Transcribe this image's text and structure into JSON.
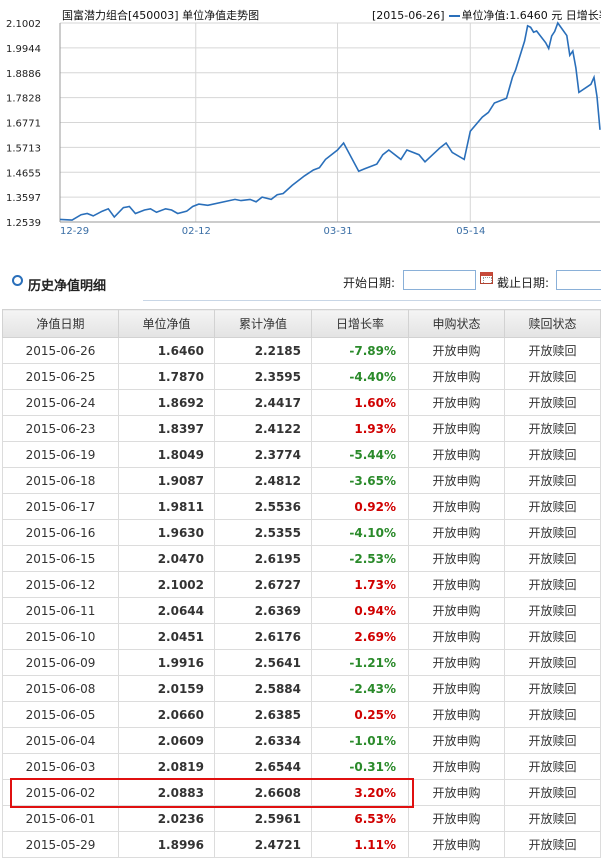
{
  "chart": {
    "title": "国富潜力组合[450003] 单位净值走势图",
    "legend": {
      "date": "[2015-06-26]",
      "series_label": "单位净值",
      "value": "1.6460",
      "unit": "元",
      "rate_label": "日增长率"
    },
    "y_ticks": [
      "2.1002",
      "1.9944",
      "1.8886",
      "1.7828",
      "1.6771",
      "1.5713",
      "1.4655",
      "1.3597",
      "1.2539"
    ],
    "x_ticks": [
      "12-29",
      "02-12",
      "03-31",
      "05-14"
    ],
    "line_color": "#2a6fba"
  },
  "chart_data": {
    "type": "line",
    "ylim": [
      1.2539,
      2.1002
    ],
    "grid": true,
    "x": [
      "2014-12-29",
      "2015-01-02",
      "2015-01-05",
      "2015-01-07",
      "2015-01-09",
      "2015-01-12",
      "2015-01-14",
      "2015-01-16",
      "2015-01-19",
      "2015-01-21",
      "2015-01-23",
      "2015-01-26",
      "2015-01-28",
      "2015-01-30",
      "2015-02-02",
      "2015-02-04",
      "2015-02-06",
      "2015-02-09",
      "2015-02-11",
      "2015-02-13",
      "2015-02-16",
      "2015-02-25",
      "2015-02-27",
      "2015-03-02",
      "2015-03-04",
      "2015-03-06",
      "2015-03-09",
      "2015-03-11",
      "2015-03-13",
      "2015-03-16",
      "2015-03-18",
      "2015-03-20",
      "2015-03-23",
      "2015-03-25",
      "2015-03-27",
      "2015-03-31",
      "2015-04-02",
      "2015-04-07",
      "2015-04-09",
      "2015-04-13",
      "2015-04-15",
      "2015-04-17",
      "2015-04-21",
      "2015-04-23",
      "2015-04-27",
      "2015-04-29",
      "2015-05-04",
      "2015-05-06",
      "2015-05-08",
      "2015-05-12",
      "2015-05-14",
      "2015-05-18",
      "2015-05-20",
      "2015-05-22",
      "2015-05-26",
      "2015-05-28",
      "2015-05-29",
      "2015-06-01",
      "2015-06-02",
      "2015-06-03",
      "2015-06-04",
      "2015-06-05",
      "2015-06-08",
      "2015-06-09",
      "2015-06-10",
      "2015-06-11",
      "2015-06-12",
      "2015-06-15",
      "2015-06-16",
      "2015-06-17",
      "2015-06-18",
      "2015-06-19",
      "2015-06-23",
      "2015-06-24",
      "2015-06-25",
      "2015-06-26"
    ],
    "series": [
      {
        "values": [
          1.265,
          1.262,
          1.285,
          1.29,
          1.28,
          1.3,
          1.31,
          1.275,
          1.315,
          1.32,
          1.29,
          1.305,
          1.31,
          1.295,
          1.31,
          1.305,
          1.29,
          1.3,
          1.32,
          1.33,
          1.325,
          1.35,
          1.345,
          1.35,
          1.34,
          1.36,
          1.35,
          1.37,
          1.375,
          1.41,
          1.43,
          1.45,
          1.475,
          1.485,
          1.52,
          1.56,
          1.59,
          1.47,
          1.48,
          1.5,
          1.54,
          1.56,
          1.52,
          1.56,
          1.54,
          1.51,
          1.57,
          1.59,
          1.55,
          1.52,
          1.64,
          1.7,
          1.72,
          1.76,
          1.78,
          1.87,
          1.8996,
          2.0236,
          2.0883,
          2.0819,
          2.0609,
          2.066,
          2.0159,
          1.9916,
          2.0451,
          2.0644,
          2.1002,
          2.047,
          1.963,
          1.9811,
          1.9087,
          1.8049,
          1.8397,
          1.8692,
          1.787,
          1.646
        ]
      }
    ]
  },
  "section": {
    "title": "历史净值明细",
    "start_label": "开始日期:",
    "start_value": "",
    "end_label": "截止日期:",
    "end_value": ""
  },
  "table": {
    "headers": [
      "净值日期",
      "单位净值",
      "累计净值",
      "日增长率",
      "申购状态",
      "赎回状态"
    ],
    "rows": [
      {
        "date": "2015-06-26",
        "nav": "1.6460",
        "acc": "2.2185",
        "chg": "-7.89%",
        "dir": "down",
        "buy": "开放申购",
        "red": "开放赎回"
      },
      {
        "date": "2015-06-25",
        "nav": "1.7870",
        "acc": "2.3595",
        "chg": "-4.40%",
        "dir": "down",
        "buy": "开放申购",
        "red": "开放赎回"
      },
      {
        "date": "2015-06-24",
        "nav": "1.8692",
        "acc": "2.4417",
        "chg": "1.60%",
        "dir": "up",
        "buy": "开放申购",
        "red": "开放赎回"
      },
      {
        "date": "2015-06-23",
        "nav": "1.8397",
        "acc": "2.4122",
        "chg": "1.93%",
        "dir": "up",
        "buy": "开放申购",
        "red": "开放赎回"
      },
      {
        "date": "2015-06-19",
        "nav": "1.8049",
        "acc": "2.3774",
        "chg": "-5.44%",
        "dir": "down",
        "buy": "开放申购",
        "red": "开放赎回"
      },
      {
        "date": "2015-06-18",
        "nav": "1.9087",
        "acc": "2.4812",
        "chg": "-3.65%",
        "dir": "down",
        "buy": "开放申购",
        "red": "开放赎回"
      },
      {
        "date": "2015-06-17",
        "nav": "1.9811",
        "acc": "2.5536",
        "chg": "0.92%",
        "dir": "up",
        "buy": "开放申购",
        "red": "开放赎回"
      },
      {
        "date": "2015-06-16",
        "nav": "1.9630",
        "acc": "2.5355",
        "chg": "-4.10%",
        "dir": "down",
        "buy": "开放申购",
        "red": "开放赎回"
      },
      {
        "date": "2015-06-15",
        "nav": "2.0470",
        "acc": "2.6195",
        "chg": "-2.53%",
        "dir": "down",
        "buy": "开放申购",
        "red": "开放赎回"
      },
      {
        "date": "2015-06-12",
        "nav": "2.1002",
        "acc": "2.6727",
        "chg": "1.73%",
        "dir": "up",
        "buy": "开放申购",
        "red": "开放赎回"
      },
      {
        "date": "2015-06-11",
        "nav": "2.0644",
        "acc": "2.6369",
        "chg": "0.94%",
        "dir": "up",
        "buy": "开放申购",
        "red": "开放赎回"
      },
      {
        "date": "2015-06-10",
        "nav": "2.0451",
        "acc": "2.6176",
        "chg": "2.69%",
        "dir": "up",
        "buy": "开放申购",
        "red": "开放赎回"
      },
      {
        "date": "2015-06-09",
        "nav": "1.9916",
        "acc": "2.5641",
        "chg": "-1.21%",
        "dir": "down",
        "buy": "开放申购",
        "red": "开放赎回"
      },
      {
        "date": "2015-06-08",
        "nav": "2.0159",
        "acc": "2.5884",
        "chg": "-2.43%",
        "dir": "down",
        "buy": "开放申购",
        "red": "开放赎回"
      },
      {
        "date": "2015-06-05",
        "nav": "2.0660",
        "acc": "2.6385",
        "chg": "0.25%",
        "dir": "up",
        "buy": "开放申购",
        "red": "开放赎回"
      },
      {
        "date": "2015-06-04",
        "nav": "2.0609",
        "acc": "2.6334",
        "chg": "-1.01%",
        "dir": "down",
        "buy": "开放申购",
        "red": "开放赎回"
      },
      {
        "date": "2015-06-03",
        "nav": "2.0819",
        "acc": "2.6544",
        "chg": "-0.31%",
        "dir": "down",
        "buy": "开放申购",
        "red": "开放赎回"
      },
      {
        "date": "2015-06-02",
        "nav": "2.0883",
        "acc": "2.6608",
        "chg": "3.20%",
        "dir": "up",
        "buy": "开放申购",
        "red": "开放赎回"
      },
      {
        "date": "2015-06-01",
        "nav": "2.0236",
        "acc": "2.5961",
        "chg": "6.53%",
        "dir": "up",
        "buy": "开放申购",
        "red": "开放赎回"
      },
      {
        "date": "2015-05-29",
        "nav": "1.8996",
        "acc": "2.4721",
        "chg": "1.11%",
        "dir": "up",
        "buy": "开放申购",
        "red": "开放赎回"
      }
    ],
    "highlight_row": 17,
    "highlight_color": "#e01010",
    "up_color": "#d00000",
    "down_color": "#2a8a2a"
  }
}
